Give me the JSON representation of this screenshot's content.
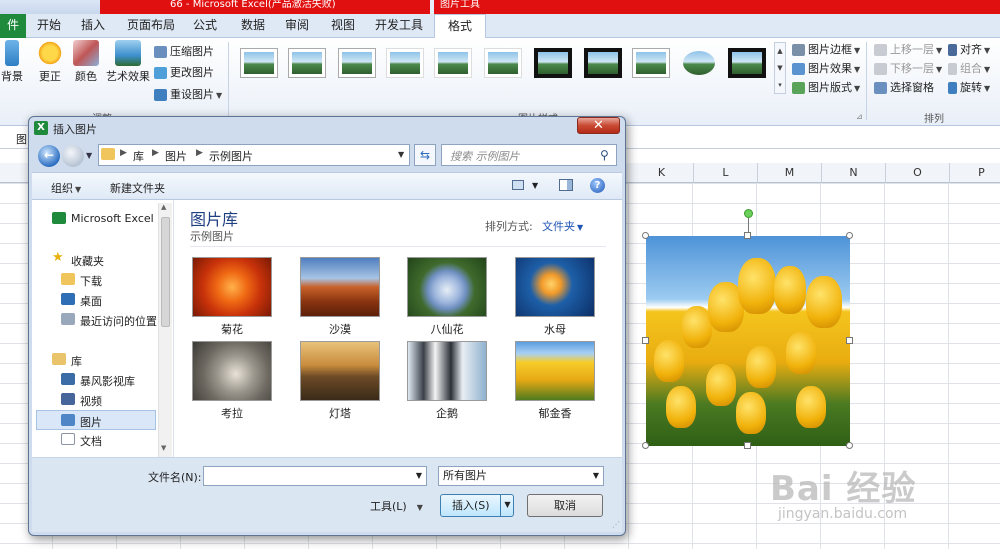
{
  "window": {
    "title": "66 - Microsoft Excel(产品激活失败)",
    "picture_tools_label": "图片工具"
  },
  "tabs": [
    "件",
    "开始",
    "插入",
    "页面布局",
    "公式",
    "数据",
    "审阅",
    "视图",
    "开发工具",
    "格式"
  ],
  "ribbon": {
    "adjust": {
      "background_label": "背景",
      "corrections_label": "更正",
      "color_label": "颜色",
      "artistic_label": "艺术效果",
      "compress_label": "压缩图片",
      "change_label": "更改图片",
      "reset_label": "重设图片",
      "group_label": "调整"
    },
    "styles": {
      "group_label": "图片样式",
      "border_label": "图片边框",
      "effects_label": "图片效果",
      "layout_label": "图片版式"
    },
    "arrange": {
      "group_label": "排列",
      "bring_forward": "上移一层",
      "send_backward": "下移一层",
      "selection_pane": "选择窗格",
      "align": "对齐",
      "group": "组合",
      "rotate": "旋转"
    }
  },
  "namebox_partial": "图",
  "columns": [
    "K",
    "L",
    "M",
    "N",
    "O",
    "P"
  ],
  "dialog": {
    "title": "插入图片",
    "close_label": "✕",
    "address": {
      "crumbs": [
        "库",
        "图片",
        "示例图片"
      ]
    },
    "search_placeholder": "搜索 示例图片",
    "toolbar": {
      "organize": "组织",
      "new_folder": "新建文件夹"
    },
    "nav": {
      "excel": "Microsoft Excel",
      "favorites": "收藏夹",
      "downloads": "下载",
      "desktop": "桌面",
      "recent": "最近访问的位置",
      "libraries": "库",
      "storm_video": "暴风影视库",
      "videos": "视频",
      "pictures": "图片",
      "documents": "文档"
    },
    "library": {
      "title": "图片库",
      "subtitle": "示例图片",
      "sort_label": "排列方式:",
      "sort_value": "文件夹"
    },
    "files": [
      "菊花",
      "沙漠",
      "八仙花",
      "水母",
      "考拉",
      "灯塔",
      "企鹅",
      "郁金香"
    ],
    "filename_label": "文件名(N):",
    "filename_value": "",
    "filetype_value": "所有图片",
    "tools_label": "工具(L)",
    "insert_label": "插入(S)",
    "cancel_label": "取消"
  },
  "watermark": {
    "logo": "Bai 经验",
    "url": "jingyan.baidu.com"
  }
}
